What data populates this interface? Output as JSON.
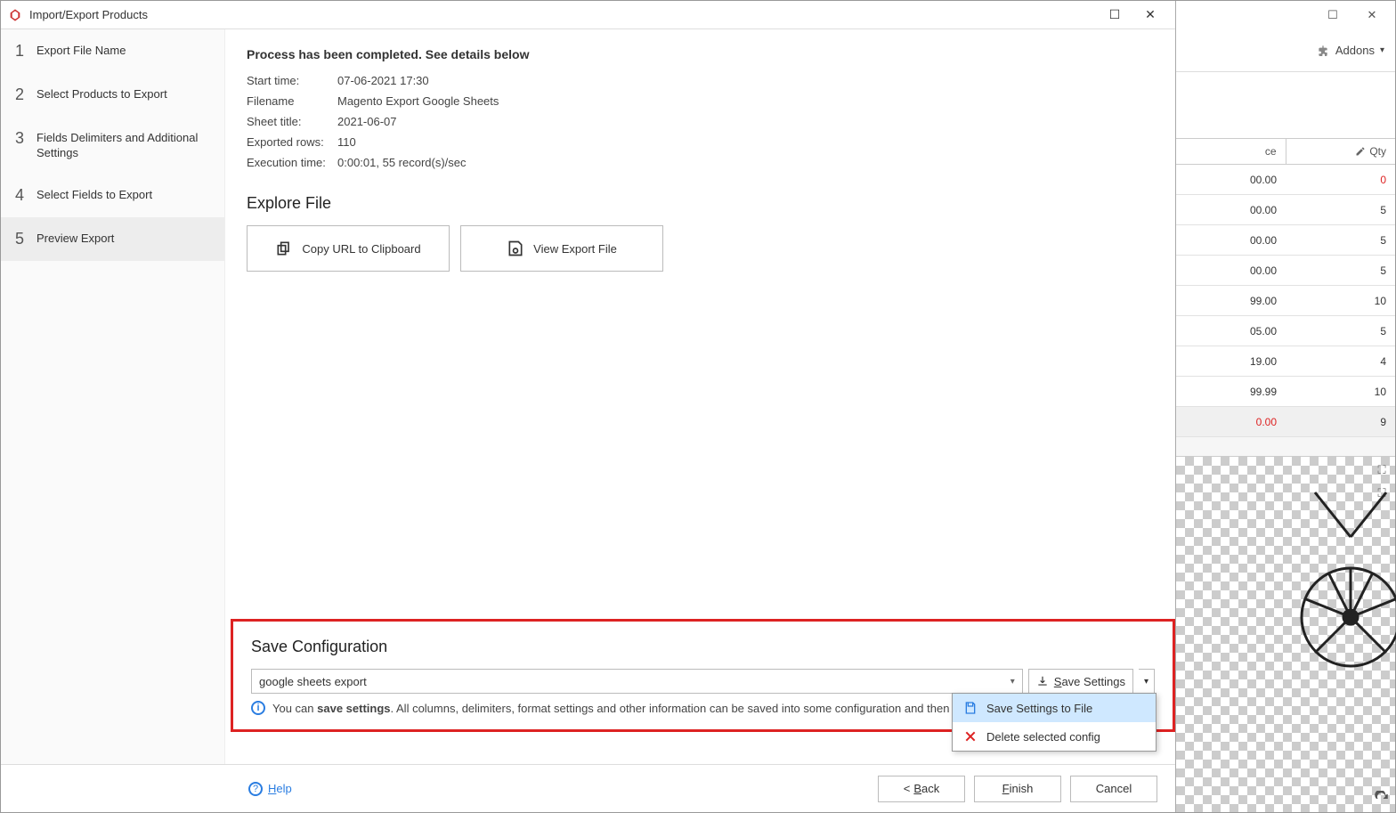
{
  "modal": {
    "title": "Import/Export Products",
    "steps": [
      {
        "num": "1",
        "label": "Export File Name"
      },
      {
        "num": "2",
        "label": "Select Products to Export"
      },
      {
        "num": "3",
        "label": "Fields Delimiters and Additional Settings"
      },
      {
        "num": "4",
        "label": "Select Fields to Export"
      },
      {
        "num": "5",
        "label": "Preview Export"
      }
    ],
    "active_step": 4,
    "process_title": "Process has been completed. See details below",
    "info": {
      "start_time_k": "Start time:",
      "start_time_v": "07-06-2021 17:30",
      "filename_k": "Filename",
      "filename_v": "Magento Export Google Sheets",
      "sheet_title_k": "Sheet title:",
      "sheet_title_v": "2021-06-07",
      "exported_rows_k": "Exported rows:",
      "exported_rows_v": "110",
      "exec_time_k": "Execution time:",
      "exec_time_v": "0:00:01, 55 record(s)/sec"
    },
    "explore_title": "Explore File",
    "copy_btn": "Copy URL to Clipboard",
    "view_btn": "View Export File",
    "save_cfg_title": "Save Configuration",
    "save_cfg_value": "google sheets export",
    "save_settings_btn": "Save Settings",
    "save_hint_pre": "You can ",
    "save_hint_bold": "save settings",
    "save_hint_post": ". All columns, delimiters, format settings and other information can be saved into some configuration and then restored.",
    "dd_save_to_file": "Save Settings to File",
    "dd_delete": "Delete selected config",
    "help": "Help",
    "back": "Back",
    "finish": "Finish",
    "cancel": "Cancel"
  },
  "bg": {
    "addons": "Addons",
    "col_ce": "ce",
    "col_qty": "Qty",
    "rows": [
      {
        "price": "00.00",
        "qty": "0",
        "qty_red": true
      },
      {
        "price": "00.00",
        "qty": "5"
      },
      {
        "price": "00.00",
        "qty": "5"
      },
      {
        "price": "00.00",
        "qty": "5"
      },
      {
        "price": "99.00",
        "qty": "10"
      },
      {
        "price": "05.00",
        "qty": "5"
      },
      {
        "price": "19.00",
        "qty": "4"
      },
      {
        "price": "99.99",
        "qty": "10"
      },
      {
        "price": "0.00",
        "qty": "9",
        "price_red": true,
        "sel": true
      }
    ]
  }
}
